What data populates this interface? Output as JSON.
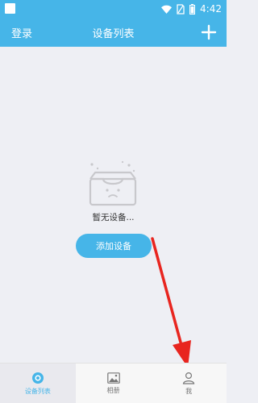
{
  "status_bar": {
    "time": "4:42"
  },
  "header": {
    "login_label": "登录",
    "title": "设备列表",
    "add_icon": "plus-icon"
  },
  "empty_state": {
    "message": "暂无设备...",
    "add_device_label": "添加设备"
  },
  "tabs": [
    {
      "label": "设备列表",
      "icon": "camera-icon",
      "active": true
    },
    {
      "label": "相册",
      "icon": "gallery-icon",
      "active": false
    },
    {
      "label": "我",
      "icon": "user-icon",
      "active": false
    }
  ],
  "colors": {
    "accent": "#46b5e8",
    "annotation_arrow": "#e8251f"
  }
}
